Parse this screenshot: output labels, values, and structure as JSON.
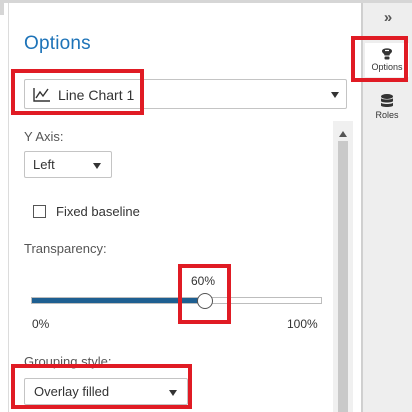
{
  "panel": {
    "title": "Options",
    "object_select": {
      "value": "Line Chart 1",
      "icon": "line-chart-icon"
    }
  },
  "options": {
    "y_axis": {
      "label": "Y Axis:",
      "value": "Left"
    },
    "fixed_baseline": {
      "label": "Fixed baseline",
      "checked": false
    },
    "transparency": {
      "label": "Transparency:",
      "value": 0.6,
      "value_text": "60%",
      "min_text": "0%",
      "max_text": "100%"
    },
    "grouping_style": {
      "label": "Grouping style:",
      "value": "Overlay filled"
    }
  },
  "right_rail": {
    "collapse_icon": "double-chevron-right-icon",
    "collapse_glyph": "»",
    "items": [
      {
        "label": "Options",
        "icon": "options-icon",
        "active": true
      },
      {
        "label": "Roles",
        "icon": "roles-icon",
        "active": false
      }
    ]
  },
  "colors": {
    "title": "#1d73b8",
    "slider_fill": "#1e5f91",
    "highlight": "#e01b24",
    "rail_background": "#eeeeee"
  }
}
